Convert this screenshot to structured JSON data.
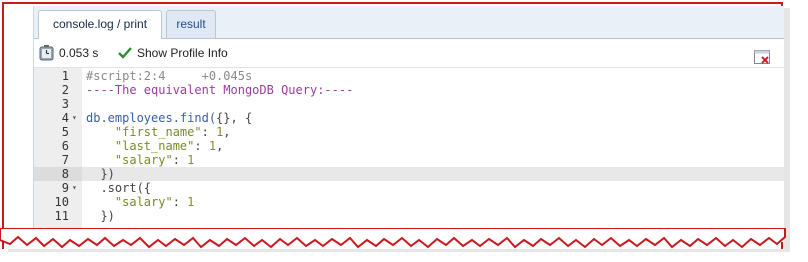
{
  "tabs": [
    {
      "label": "console.log / print",
      "active": true
    },
    {
      "label": "result",
      "active": false
    }
  ],
  "toolbar": {
    "time": "0.053 s",
    "profile_label": "Show Profile Info"
  },
  "editor": {
    "active_line": 8,
    "lines": [
      {
        "n": "1",
        "fold": false,
        "tokens": [
          {
            "t": "#script:2:4     +0.045s",
            "c": "c-comment"
          }
        ]
      },
      {
        "n": "2",
        "fold": false,
        "tokens": [
          {
            "t": "----The equivalent MongoDB Query:----",
            "c": "c-dash"
          }
        ]
      },
      {
        "n": "3",
        "fold": false,
        "tokens": []
      },
      {
        "n": "4",
        "fold": true,
        "tokens": [
          {
            "t": "db.employees.find(",
            "c": "c-ident"
          },
          {
            "t": "{}, {",
            "c": "c-punc"
          }
        ]
      },
      {
        "n": "5",
        "fold": false,
        "tokens": [
          {
            "t": "    ",
            "c": "c-punc"
          },
          {
            "t": "\"first_name\"",
            "c": "c-str"
          },
          {
            "t": ": ",
            "c": "c-punc"
          },
          {
            "t": "1",
            "c": "c-num"
          },
          {
            "t": ",",
            "c": "c-punc"
          }
        ]
      },
      {
        "n": "6",
        "fold": false,
        "tokens": [
          {
            "t": "    ",
            "c": "c-punc"
          },
          {
            "t": "\"last_name\"",
            "c": "c-str"
          },
          {
            "t": ": ",
            "c": "c-punc"
          },
          {
            "t": "1",
            "c": "c-num"
          },
          {
            "t": ",",
            "c": "c-punc"
          }
        ]
      },
      {
        "n": "7",
        "fold": false,
        "tokens": [
          {
            "t": "    ",
            "c": "c-punc"
          },
          {
            "t": "\"salary\"",
            "c": "c-str"
          },
          {
            "t": ": ",
            "c": "c-punc"
          },
          {
            "t": "1",
            "c": "c-num"
          }
        ]
      },
      {
        "n": "8",
        "fold": false,
        "tokens": [
          {
            "t": "  })",
            "c": "c-punc"
          }
        ]
      },
      {
        "n": "9",
        "fold": true,
        "tokens": [
          {
            "t": "  .sort({",
            "c": "c-punc"
          }
        ]
      },
      {
        "n": "10",
        "fold": false,
        "tokens": [
          {
            "t": "    ",
            "c": "c-punc"
          },
          {
            "t": "\"salary\"",
            "c": "c-str"
          },
          {
            "t": ": ",
            "c": "c-punc"
          },
          {
            "t": "1",
            "c": "c-num"
          }
        ]
      },
      {
        "n": "11",
        "fold": false,
        "tokens": [
          {
            "t": "  })",
            "c": "c-punc"
          }
        ]
      }
    ]
  },
  "colors": {
    "frame": "#c8191f",
    "tab_text": "#1f4e8c",
    "gutter": "#eeeeee",
    "active_line": "#e8e8e8"
  },
  "icons": [
    "stopwatch-icon",
    "checkmark-icon",
    "close-icon",
    "fold-arrow-icon"
  ]
}
